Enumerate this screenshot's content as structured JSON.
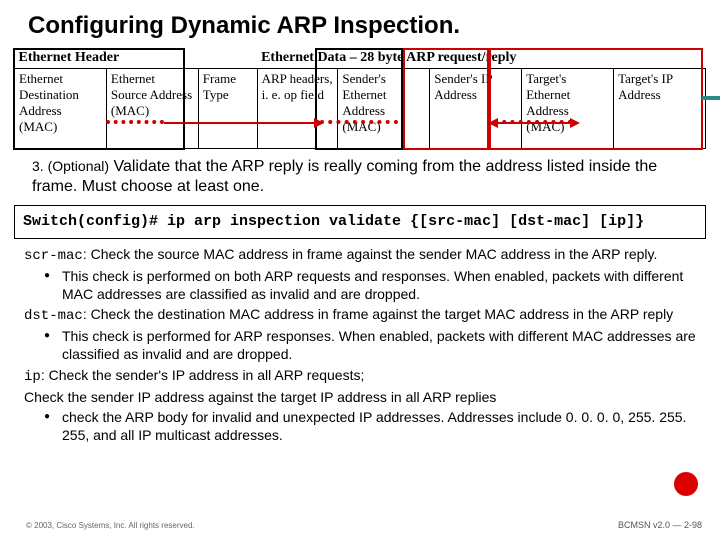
{
  "title": "Configuring Dynamic ARP Inspection.",
  "diagram": {
    "header_left": "Ethernet Header",
    "header_right": "Ethernet Data – 28 byte ARP request/reply",
    "cells": [
      "Ethernet Destination Address (MAC)",
      "Ethernet Source Address (MAC)",
      "Frame Type",
      "ARP headers, i. e. op field",
      "Sender's Ethernet Address (MAC)",
      "Sender's IP Address",
      "Target's Ethernet Address (MAC)",
      "Target's IP Address"
    ]
  },
  "step": {
    "num": "3. (Optional)",
    "text": " Validate that the ARP reply is really coming from the address listed inside the frame.  Must choose at least one."
  },
  "command": "Switch(config)# ip arp inspection validate {[src-mac] [dst-mac] [ip]}",
  "desc": {
    "l1a": "scr-mac",
    "l1b": ": Check the source MAC address in frame against the sender MAC address in the ARP reply.",
    "l2": "This check is performed on both ARP requests and responses. When enabled, packets with different MAC addresses are classified as invalid and are dropped.",
    "l3a": "dst-mac",
    "l3b": ": Check the destination MAC address in frame against the target MAC address in the ARP reply",
    "l4": "This check is performed for ARP responses. When enabled, packets with different MAC addresses are classified as invalid and are dropped.",
    "l5a": "ip",
    "l5b": ": Check the sender's IP address in all ARP requests;",
    "l6": "Check the sender IP address against the target IP address in all ARP replies",
    "l7": "check the ARP body for invalid and unexpected IP addresses. Addresses include 0. 0. 0. 0, 255. 255. 255, and all IP multicast addresses."
  },
  "footer": {
    "left": "© 2003, Cisco Systems, Inc. All rights reserved.",
    "right": "BCMSN v2.0 — 2-98"
  }
}
